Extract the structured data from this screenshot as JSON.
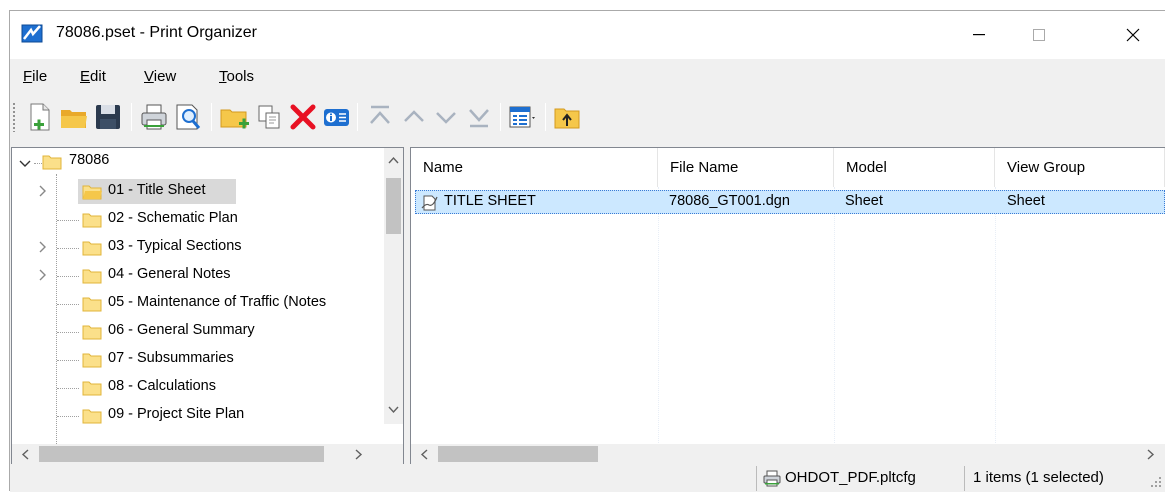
{
  "window": {
    "title": "78086.pset - Print Organizer",
    "minimize_label": "—",
    "maximize_label": "☐",
    "close_label": "✕"
  },
  "menu": [
    {
      "first": "F",
      "rest": "ile"
    },
    {
      "first": "E",
      "rest": "dit"
    },
    {
      "first": "V",
      "rest": "iew"
    },
    {
      "first": "T",
      "rest": "ools"
    }
  ],
  "toolbar": {
    "icons": [
      "new-set-icon",
      "open-folder-icon",
      "save-icon",
      "print-icon",
      "preview-icon",
      "add-folder-icon",
      "copy-icon",
      "delete-icon",
      "properties-icon",
      "move-top-icon",
      "move-up-icon",
      "move-down-icon",
      "move-bottom-icon",
      "view-options-icon",
      "folder-up-icon"
    ]
  },
  "tree": {
    "root": "78086",
    "items": [
      {
        "label": "01 - Title Sheet",
        "expandable": true,
        "selected": true
      },
      {
        "label": "02 - Schematic Plan",
        "expandable": false
      },
      {
        "label": "03 - Typical Sections",
        "expandable": true
      },
      {
        "label": "04 - General Notes",
        "expandable": true
      },
      {
        "label": "05 - Maintenance of Traffic (Notes",
        "expandable": false
      },
      {
        "label": "06 - General Summary",
        "expandable": false
      },
      {
        "label": "07 - Subsummaries",
        "expandable": false
      },
      {
        "label": "08 - Calculations",
        "expandable": false
      },
      {
        "label": "09 - Project Site Plan",
        "expandable": false
      }
    ]
  },
  "list": {
    "columns": [
      "Name",
      "File Name",
      "Model",
      "View Group"
    ],
    "rows": [
      {
        "name": "TITLE SHEET",
        "file_name": "78086_GT001.dgn",
        "model": "Sheet",
        "view_group": "Sheet",
        "selected": true
      }
    ]
  },
  "status": {
    "printer_config": "OHDOT_PDF.pltcfg",
    "selection": "1 items (1 selected)"
  },
  "colors": {
    "folder": "#f5c74a",
    "selection_bg": "#cce8ff",
    "delete_red": "#e81123",
    "accent_blue": "#1e6fd0"
  }
}
